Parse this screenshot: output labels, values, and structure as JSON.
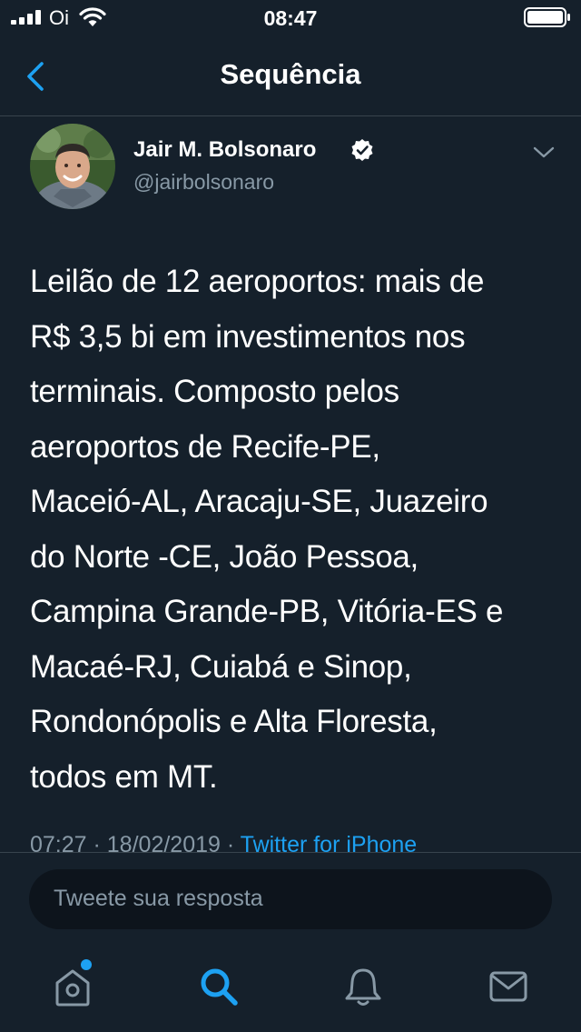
{
  "status_bar": {
    "carrier": "Oi",
    "time": "08:47"
  },
  "nav": {
    "title": "Sequência"
  },
  "tweet": {
    "author_name": "Jair M. Bolsonaro",
    "author_handle": "@jairbolsonaro",
    "verified": true,
    "text_lines": [
      "Leilão de 12 aeroportos: mais de",
      "R$ 3,5 bi em investimentos nos",
      "terminais. Composto pelos",
      "aeroportos de Recife-PE,",
      "Maceió-AL, Aracaju-SE, Juazeiro",
      "do Norte -CE, João Pessoa,",
      "Campina Grande-PB, Vitória-ES e",
      "Macaé-RJ, Cuiabá e Sinop,",
      "Rondonópolis e Alta Floresta,",
      "todos em MT."
    ],
    "meta_time": "07:27",
    "meta_date": "18/02/2019",
    "meta_separator": " · ",
    "meta_source": "Twitter for iPhone"
  },
  "reply": {
    "placeholder": "Tweete sua resposta"
  },
  "tab_bar": {
    "tabs": [
      {
        "icon": "home-icon",
        "active": false
      },
      {
        "icon": "search-icon",
        "active": true
      },
      {
        "icon": "bell-icon",
        "active": false
      },
      {
        "icon": "mail-icon",
        "active": false
      }
    ],
    "home_has_notification": true
  },
  "colors": {
    "background": "#15202b",
    "accent": "#1da1f2",
    "secondary_text": "#8899a6",
    "divider": "#38444d"
  }
}
